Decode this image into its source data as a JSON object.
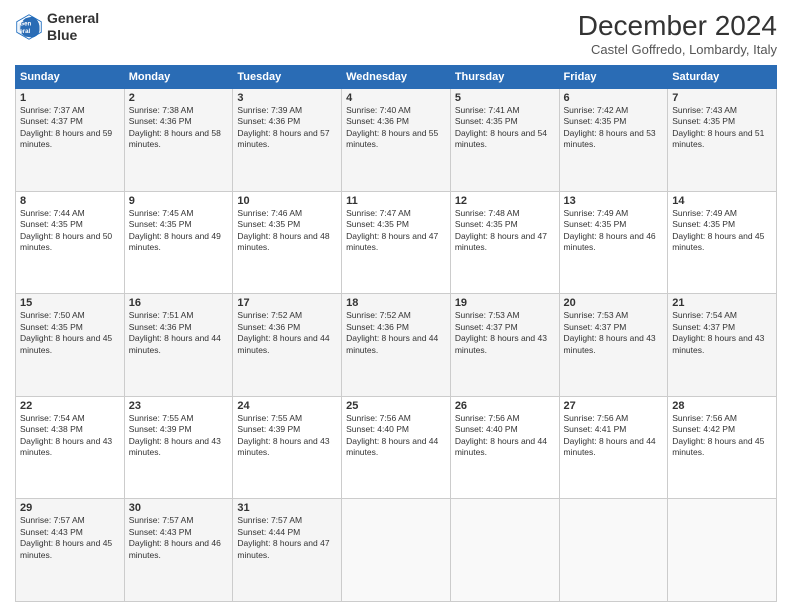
{
  "logo": {
    "line1": "General",
    "line2": "Blue"
  },
  "title": "December 2024",
  "subtitle": "Castel Goffredo, Lombardy, Italy",
  "headers": [
    "Sunday",
    "Monday",
    "Tuesday",
    "Wednesday",
    "Thursday",
    "Friday",
    "Saturday"
  ],
  "weeks": [
    [
      {
        "day": "1",
        "sunrise": "7:37 AM",
        "sunset": "4:37 PM",
        "daylight": "8 hours and 59 minutes."
      },
      {
        "day": "2",
        "sunrise": "7:38 AM",
        "sunset": "4:36 PM",
        "daylight": "8 hours and 58 minutes."
      },
      {
        "day": "3",
        "sunrise": "7:39 AM",
        "sunset": "4:36 PM",
        "daylight": "8 hours and 57 minutes."
      },
      {
        "day": "4",
        "sunrise": "7:40 AM",
        "sunset": "4:36 PM",
        "daylight": "8 hours and 55 minutes."
      },
      {
        "day": "5",
        "sunrise": "7:41 AM",
        "sunset": "4:35 PM",
        "daylight": "8 hours and 54 minutes."
      },
      {
        "day": "6",
        "sunrise": "7:42 AM",
        "sunset": "4:35 PM",
        "daylight": "8 hours and 53 minutes."
      },
      {
        "day": "7",
        "sunrise": "7:43 AM",
        "sunset": "4:35 PM",
        "daylight": "8 hours and 51 minutes."
      }
    ],
    [
      {
        "day": "8",
        "sunrise": "7:44 AM",
        "sunset": "4:35 PM",
        "daylight": "8 hours and 50 minutes."
      },
      {
        "day": "9",
        "sunrise": "7:45 AM",
        "sunset": "4:35 PM",
        "daylight": "8 hours and 49 minutes."
      },
      {
        "day": "10",
        "sunrise": "7:46 AM",
        "sunset": "4:35 PM",
        "daylight": "8 hours and 48 minutes."
      },
      {
        "day": "11",
        "sunrise": "7:47 AM",
        "sunset": "4:35 PM",
        "daylight": "8 hours and 47 minutes."
      },
      {
        "day": "12",
        "sunrise": "7:48 AM",
        "sunset": "4:35 PM",
        "daylight": "8 hours and 47 minutes."
      },
      {
        "day": "13",
        "sunrise": "7:49 AM",
        "sunset": "4:35 PM",
        "daylight": "8 hours and 46 minutes."
      },
      {
        "day": "14",
        "sunrise": "7:49 AM",
        "sunset": "4:35 PM",
        "daylight": "8 hours and 45 minutes."
      }
    ],
    [
      {
        "day": "15",
        "sunrise": "7:50 AM",
        "sunset": "4:35 PM",
        "daylight": "8 hours and 45 minutes."
      },
      {
        "day": "16",
        "sunrise": "7:51 AM",
        "sunset": "4:36 PM",
        "daylight": "8 hours and 44 minutes."
      },
      {
        "day": "17",
        "sunrise": "7:52 AM",
        "sunset": "4:36 PM",
        "daylight": "8 hours and 44 minutes."
      },
      {
        "day": "18",
        "sunrise": "7:52 AM",
        "sunset": "4:36 PM",
        "daylight": "8 hours and 44 minutes."
      },
      {
        "day": "19",
        "sunrise": "7:53 AM",
        "sunset": "4:37 PM",
        "daylight": "8 hours and 43 minutes."
      },
      {
        "day": "20",
        "sunrise": "7:53 AM",
        "sunset": "4:37 PM",
        "daylight": "8 hours and 43 minutes."
      },
      {
        "day": "21",
        "sunrise": "7:54 AM",
        "sunset": "4:37 PM",
        "daylight": "8 hours and 43 minutes."
      }
    ],
    [
      {
        "day": "22",
        "sunrise": "7:54 AM",
        "sunset": "4:38 PM",
        "daylight": "8 hours and 43 minutes."
      },
      {
        "day": "23",
        "sunrise": "7:55 AM",
        "sunset": "4:39 PM",
        "daylight": "8 hours and 43 minutes."
      },
      {
        "day": "24",
        "sunrise": "7:55 AM",
        "sunset": "4:39 PM",
        "daylight": "8 hours and 43 minutes."
      },
      {
        "day": "25",
        "sunrise": "7:56 AM",
        "sunset": "4:40 PM",
        "daylight": "8 hours and 44 minutes."
      },
      {
        "day": "26",
        "sunrise": "7:56 AM",
        "sunset": "4:40 PM",
        "daylight": "8 hours and 44 minutes."
      },
      {
        "day": "27",
        "sunrise": "7:56 AM",
        "sunset": "4:41 PM",
        "daylight": "8 hours and 44 minutes."
      },
      {
        "day": "28",
        "sunrise": "7:56 AM",
        "sunset": "4:42 PM",
        "daylight": "8 hours and 45 minutes."
      }
    ],
    [
      {
        "day": "29",
        "sunrise": "7:57 AM",
        "sunset": "4:43 PM",
        "daylight": "8 hours and 45 minutes."
      },
      {
        "day": "30",
        "sunrise": "7:57 AM",
        "sunset": "4:43 PM",
        "daylight": "8 hours and 46 minutes."
      },
      {
        "day": "31",
        "sunrise": "7:57 AM",
        "sunset": "4:44 PM",
        "daylight": "8 hours and 47 minutes."
      },
      null,
      null,
      null,
      null
    ]
  ]
}
